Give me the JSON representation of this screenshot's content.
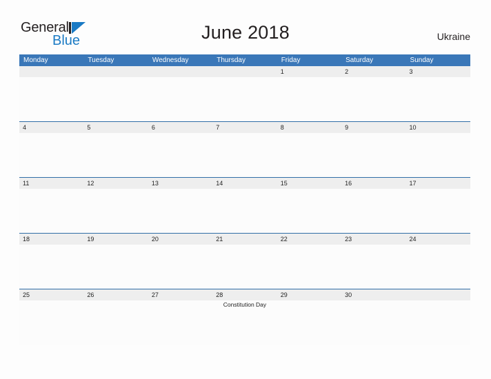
{
  "brand": {
    "name_part1": "General",
    "name_part2": "Blue",
    "mark_icon": "triangle-logo-icon",
    "accent_color": "#1a7ac4",
    "text_color": "#231f20"
  },
  "header": {
    "title": "June 2018",
    "country": "Ukraine"
  },
  "calendar": {
    "header_bg_color": "#3a77b8",
    "date_band_color": "#eeeeee",
    "row_border_color": "#2f6da6",
    "month": "June",
    "year": "2018",
    "weekdays": [
      {
        "label": "Monday"
      },
      {
        "label": "Tuesday"
      },
      {
        "label": "Wednesday"
      },
      {
        "label": "Thursday"
      },
      {
        "label": "Friday"
      },
      {
        "label": "Saturday"
      },
      {
        "label": "Sunday"
      }
    ],
    "weeks": [
      {
        "days": [
          {
            "date": "",
            "event": ""
          },
          {
            "date": "",
            "event": ""
          },
          {
            "date": "",
            "event": ""
          },
          {
            "date": "",
            "event": ""
          },
          {
            "date": "1",
            "event": ""
          },
          {
            "date": "2",
            "event": ""
          },
          {
            "date": "3",
            "event": ""
          }
        ]
      },
      {
        "days": [
          {
            "date": "4",
            "event": ""
          },
          {
            "date": "5",
            "event": ""
          },
          {
            "date": "6",
            "event": ""
          },
          {
            "date": "7",
            "event": ""
          },
          {
            "date": "8",
            "event": ""
          },
          {
            "date": "9",
            "event": ""
          },
          {
            "date": "10",
            "event": ""
          }
        ]
      },
      {
        "days": [
          {
            "date": "11",
            "event": ""
          },
          {
            "date": "12",
            "event": ""
          },
          {
            "date": "13",
            "event": ""
          },
          {
            "date": "14",
            "event": ""
          },
          {
            "date": "15",
            "event": ""
          },
          {
            "date": "16",
            "event": ""
          },
          {
            "date": "17",
            "event": ""
          }
        ]
      },
      {
        "days": [
          {
            "date": "18",
            "event": ""
          },
          {
            "date": "19",
            "event": ""
          },
          {
            "date": "20",
            "event": ""
          },
          {
            "date": "21",
            "event": ""
          },
          {
            "date": "22",
            "event": ""
          },
          {
            "date": "23",
            "event": ""
          },
          {
            "date": "24",
            "event": ""
          }
        ]
      },
      {
        "days": [
          {
            "date": "25",
            "event": ""
          },
          {
            "date": "26",
            "event": ""
          },
          {
            "date": "27",
            "event": ""
          },
          {
            "date": "28",
            "event": "Constitution Day"
          },
          {
            "date": "29",
            "event": ""
          },
          {
            "date": "30",
            "event": ""
          },
          {
            "date": "",
            "event": ""
          }
        ]
      }
    ]
  }
}
